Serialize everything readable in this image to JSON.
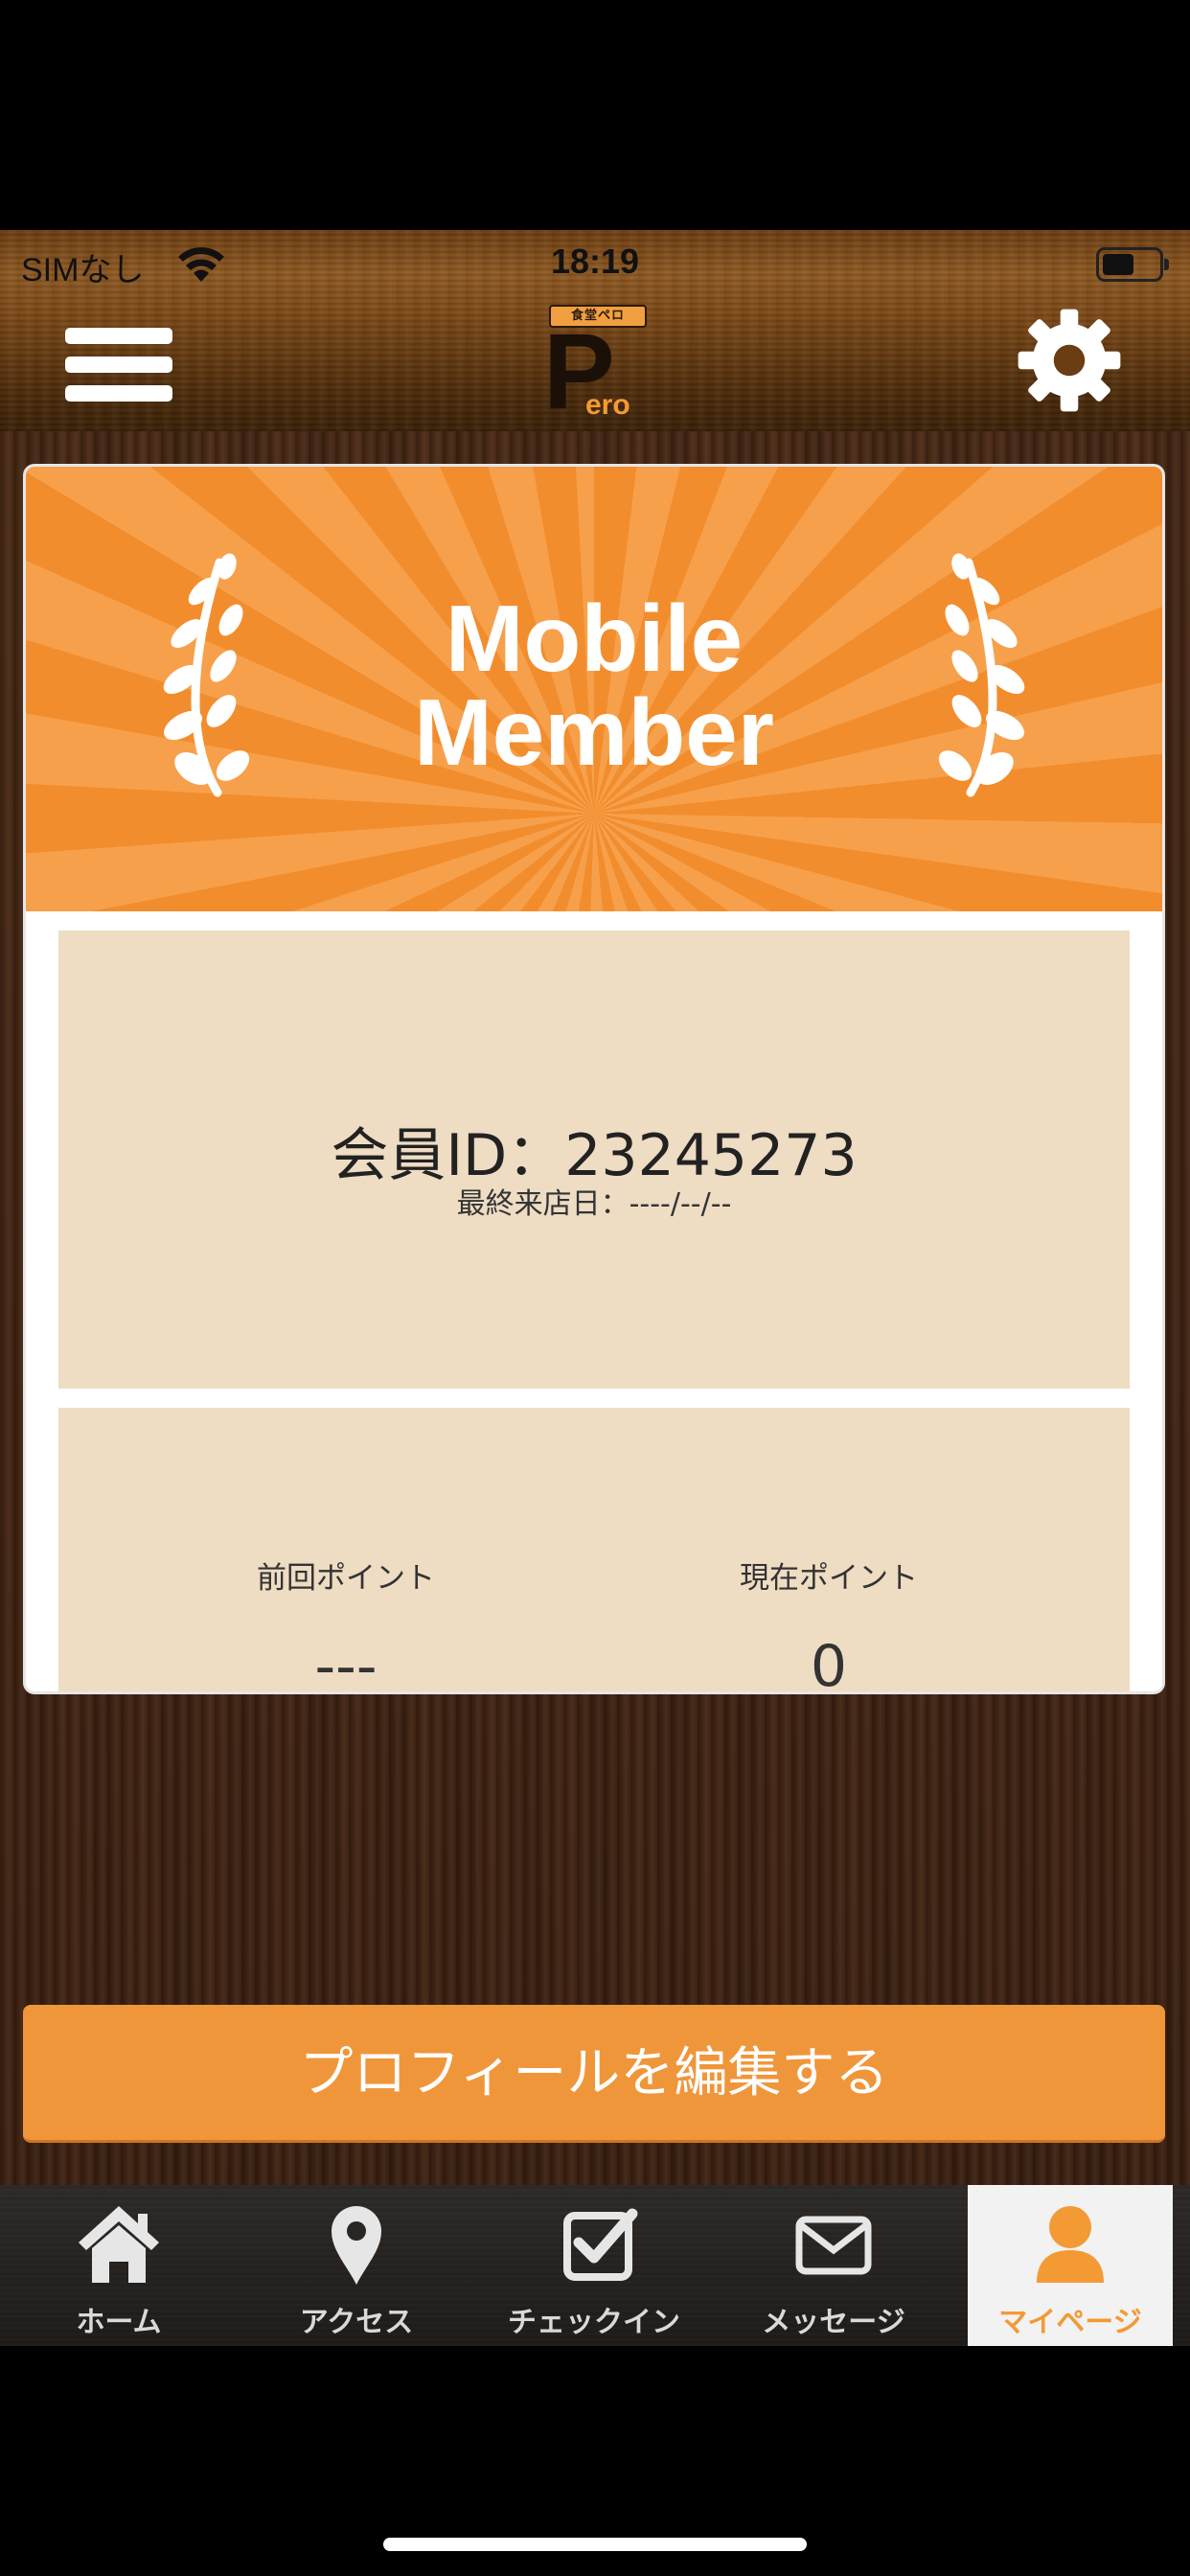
{
  "status_bar": {
    "carrier": "SIMなし",
    "time": "18:19"
  },
  "header": {
    "logo_badge": "食堂ペロ",
    "logo_letter": "P",
    "logo_text": "ero"
  },
  "card": {
    "title_line1": "Mobile",
    "title_line2": "Member",
    "member_id": "会員ID：23245273",
    "last_visit": "最終来店日：----/--/--",
    "points": {
      "previous_label": "前回ポイント",
      "previous_value": "---",
      "current_label": "現在ポイント",
      "current_value": "0"
    }
  },
  "edit_profile_label": "プロフィールを編集する",
  "tabs": [
    {
      "label": "ホーム",
      "icon": "home-icon",
      "active": false
    },
    {
      "label": "アクセス",
      "icon": "map-pin-icon",
      "active": false
    },
    {
      "label": "チェックイン",
      "icon": "checkin-icon",
      "active": false
    },
    {
      "label": "メッセージ",
      "icon": "mail-icon",
      "active": false
    },
    {
      "label": "マイページ",
      "icon": "person-icon",
      "active": true
    }
  ],
  "colors": {
    "accent_orange": "#f0963a",
    "panel_beige": "#eedcc3",
    "tab_active_text": "#f39a35"
  }
}
